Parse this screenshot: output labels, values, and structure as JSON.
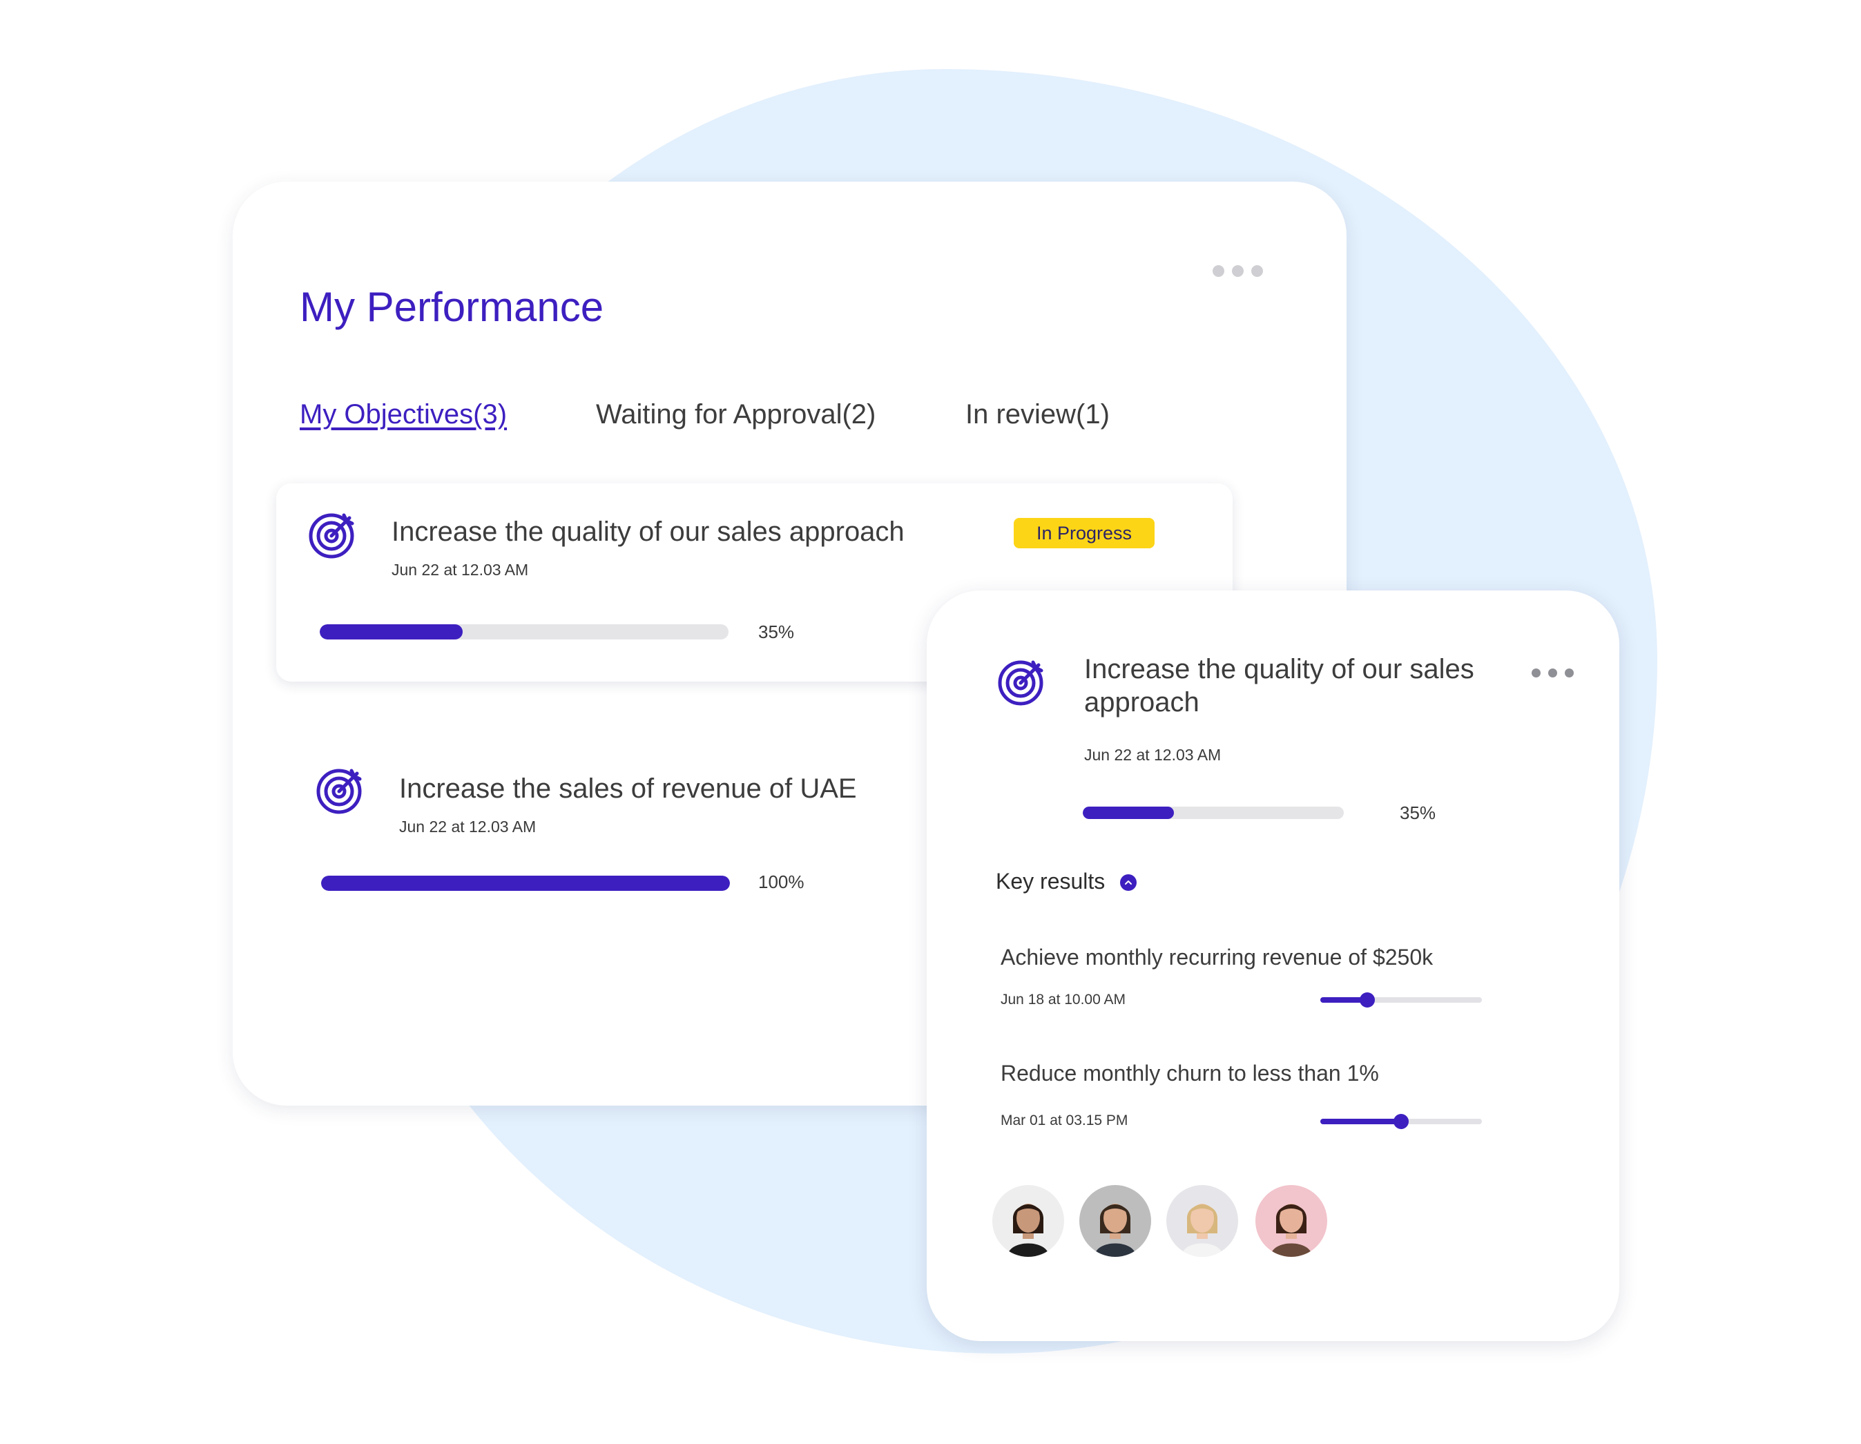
{
  "page": {
    "title": "My Performance"
  },
  "tabs": [
    {
      "label": "My Objectives(3)",
      "active": true
    },
    {
      "label": "Waiting for Approval(2)",
      "active": false
    },
    {
      "label": "In review(1)",
      "active": false
    }
  ],
  "objectives": [
    {
      "title": "Increase the quality of our sales approach",
      "date": "Jun 22 at 12.03 AM",
      "status": "In Progress",
      "progress": 0.35,
      "progress_label": "35%",
      "icon": "target-icon"
    },
    {
      "title": "Increase the sales of revenue of UAE",
      "date": "Jun 22 at 12.03 AM",
      "progress": 1.0,
      "progress_label": "100%",
      "icon": "target-icon"
    }
  ],
  "detail": {
    "title": "Increase the quality of our sales approach",
    "date": "Jun 22 at 12.03 AM",
    "progress": 0.35,
    "progress_label": "35%",
    "key_results_label": "Key results",
    "key_results": [
      {
        "title": "Achieve monthly recurring revenue of $250k",
        "date": "Jun 18 at 10.00 AM",
        "progress": 0.29
      },
      {
        "title": "Reduce monthly churn to less than 1%",
        "date": "Mar 01 at 03.15 PM",
        "progress": 0.5
      }
    ],
    "assignees": [
      {
        "name": "avatar-1",
        "bg": "#eeeeee",
        "hair": "#2a1a12",
        "skin": "#c8987a",
        "shirt": "#1c1c1c"
      },
      {
        "name": "avatar-2",
        "bg": "#bdbdbd",
        "hair": "#3a2a1e",
        "skin": "#d9a98a",
        "shirt": "#2c3440"
      },
      {
        "name": "avatar-3",
        "bg": "#e6e6ea",
        "hair": "#d8b77e",
        "skin": "#f0c8ac",
        "shirt": "#f4f4f4"
      },
      {
        "name": "avatar-4",
        "bg": "#f2c4cc",
        "hair": "#3b2115",
        "skin": "#e6b39a",
        "shirt": "#6a4a3a"
      }
    ]
  },
  "colors": {
    "accent": "#3d1fc0",
    "badge": "#fcd516",
    "blob": "#e3f0fd"
  }
}
